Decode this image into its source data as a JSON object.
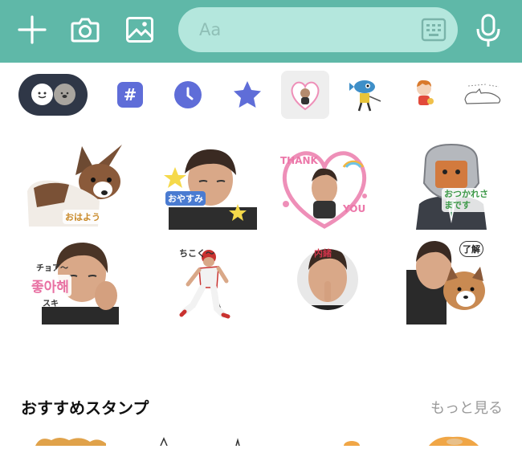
{
  "toolbar": {
    "input_placeholder": "Aa",
    "icons": [
      "plus-icon",
      "camera-icon",
      "image-icon",
      "keyboard-icon",
      "microphone-icon"
    ]
  },
  "tabs": {
    "items": [
      "emoji",
      "hashtag",
      "recent",
      "favorites",
      "sticker-pack-selected",
      "sticker-pack-fish",
      "sticker-pack-character",
      "sticker-pack-cat"
    ],
    "selected": "sticker-pack-selected"
  },
  "stickers": {
    "s1_caption": "おはよう",
    "s2_caption": "おやすみ",
    "s3_caption_top": "THANK",
    "s3_caption_bottom": "YOU",
    "s4_caption": "おつかれさまです",
    "s5_caption_top": "チョア〜",
    "s5_caption_mid": "좋아해",
    "s5_caption_bottom": "スキ",
    "s6_caption": "ちこく〜",
    "s7_caption": "内緒",
    "s8_caption": "了解"
  },
  "recommend": {
    "title": "おすすめスタンプ",
    "more_label": "もっと見る"
  },
  "colors": {
    "topbar": "#5fb8a8",
    "input": "#b4e7dd",
    "accent_blue": "#5f6dd8",
    "pill_dark": "#2f3747"
  }
}
